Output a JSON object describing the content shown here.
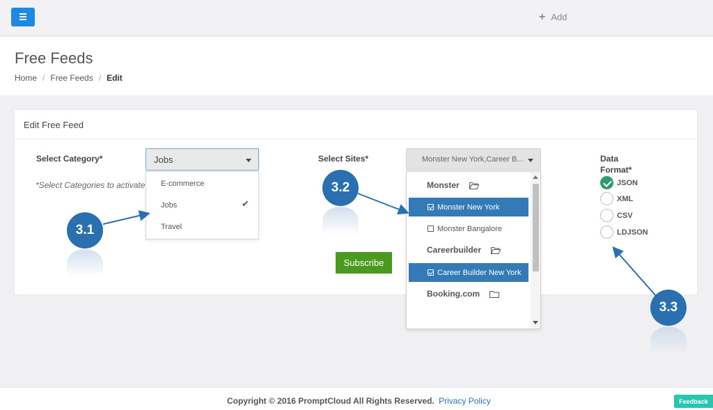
{
  "topbar": {
    "menu_icon": "hamburger-icon",
    "add_label": "Add",
    "add_icon": "plus-icon"
  },
  "header": {
    "title": "Free Feeds",
    "breadcrumb": [
      "Home",
      "Free Feeds",
      "Edit"
    ]
  },
  "card": {
    "title": "Edit Free Feed",
    "category_label": "Select Category*",
    "category_value": "Jobs",
    "category_hint": "*Select Categories to activate",
    "category_options": [
      {
        "label": "E-commerce",
        "selected": false
      },
      {
        "label": "Jobs",
        "selected": true
      },
      {
        "label": "Travel",
        "selected": false
      }
    ],
    "sites_label": "Select Sites*",
    "sites_value": "Monster New York,Career B...",
    "site_groups": [
      {
        "label": "Monster",
        "icon": "folder-icon"
      },
      {
        "label": "Careerbuilder",
        "icon": "folder-icon"
      },
      {
        "label": "Booking.com",
        "icon": "folder-icon"
      }
    ],
    "site_items": [
      {
        "label": "Monster New York",
        "selected": true
      },
      {
        "label": "Monster Bangalore",
        "selected": false
      },
      {
        "label": "Career Builder New York",
        "selected": true
      }
    ],
    "format_label_1": "Data",
    "format_label_2": "Format*",
    "formats": [
      {
        "label": "JSON",
        "checked": true
      },
      {
        "label": "XML",
        "checked": false
      },
      {
        "label": "CSV",
        "checked": false
      },
      {
        "label": "LDJSON",
        "checked": false
      }
    ],
    "subscribe_label": "Subscribe"
  },
  "annotations": [
    "3.1",
    "3.2",
    "3.3"
  ],
  "footer": {
    "copyright": "Copyright © 2016 PromptCloud All Rights Reserved.",
    "privacy_link": "Privacy Policy",
    "feedback_label": "Feedback"
  },
  "colors": {
    "primary": "#1e88e5",
    "selected_item": "#337ab7",
    "subscribe": "#4a9a1f",
    "radio_checked": "#2e9a6f",
    "callout": "#2a6fb0",
    "feedback": "#26c6b0"
  }
}
